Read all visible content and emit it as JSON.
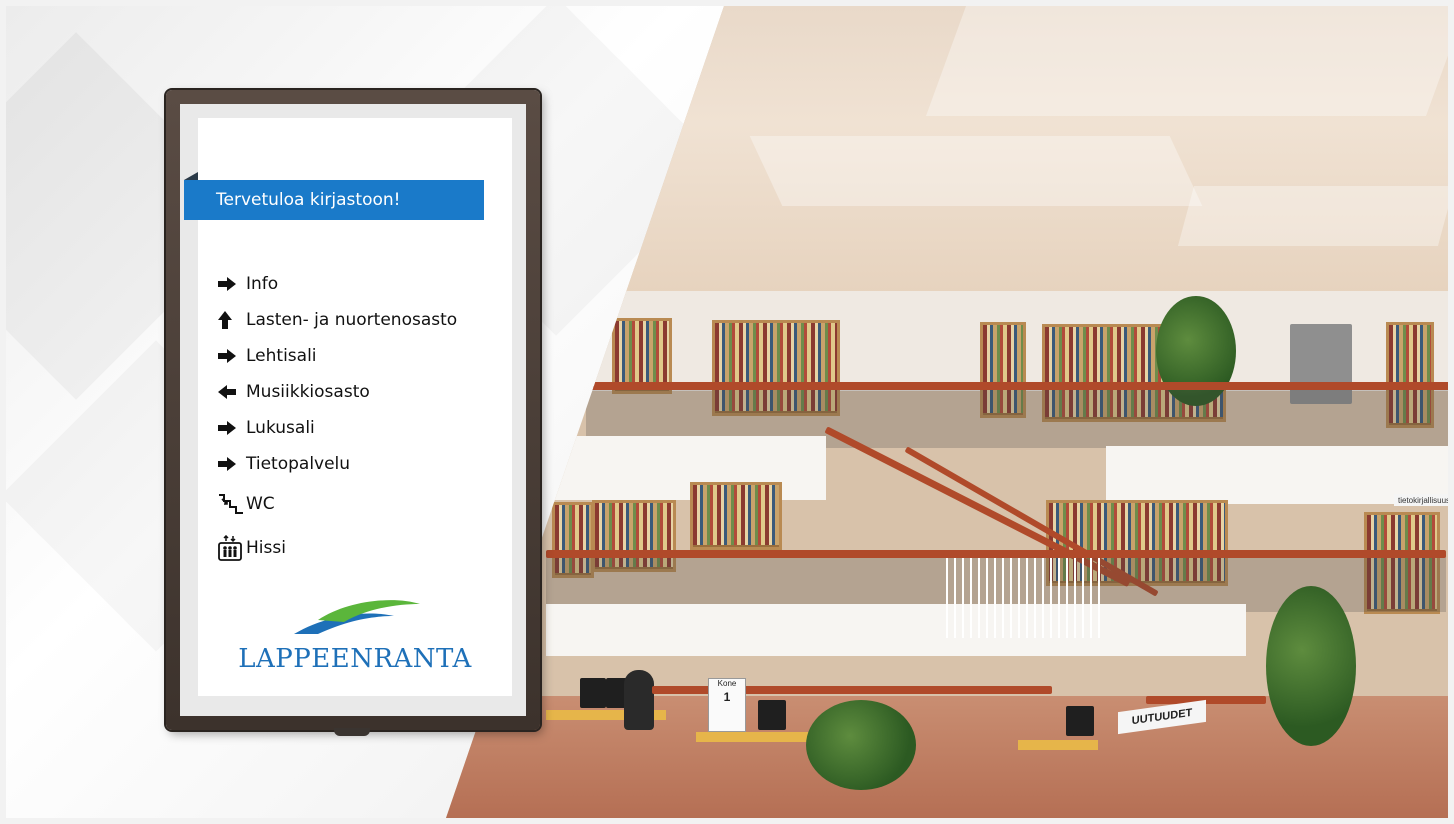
{
  "display": {
    "welcome": "Tervetuloa kirjastoon!",
    "directions": [
      {
        "icon": "arrow-right-icon",
        "label": "Info"
      },
      {
        "icon": "arrow-up-icon",
        "label": "Lasten- ja nuortenosasto"
      },
      {
        "icon": "arrow-right-icon",
        "label": "Lehtisali"
      },
      {
        "icon": "arrow-left-icon",
        "label": "Musiikkiosasto"
      },
      {
        "icon": "arrow-right-icon",
        "label": "Lukusali"
      },
      {
        "icon": "arrow-right-icon",
        "label": "Tietopalvelu"
      },
      {
        "icon": "stairs-down-icon",
        "label": "WC"
      },
      {
        "icon": "elevator-icon",
        "label": "Hissi"
      }
    ],
    "logo_text": "LAPPEENRANTA"
  },
  "photo_signs": {
    "uutuudet": "UUTUUDET",
    "tietokirjallisuus": "tietokirjallisuus",
    "kone_label": "Kone",
    "kone_number": "1"
  },
  "colors": {
    "banner": "#1a7ac9",
    "logo_blue": "#1e70b8",
    "logo_green": "#5bb63b"
  }
}
